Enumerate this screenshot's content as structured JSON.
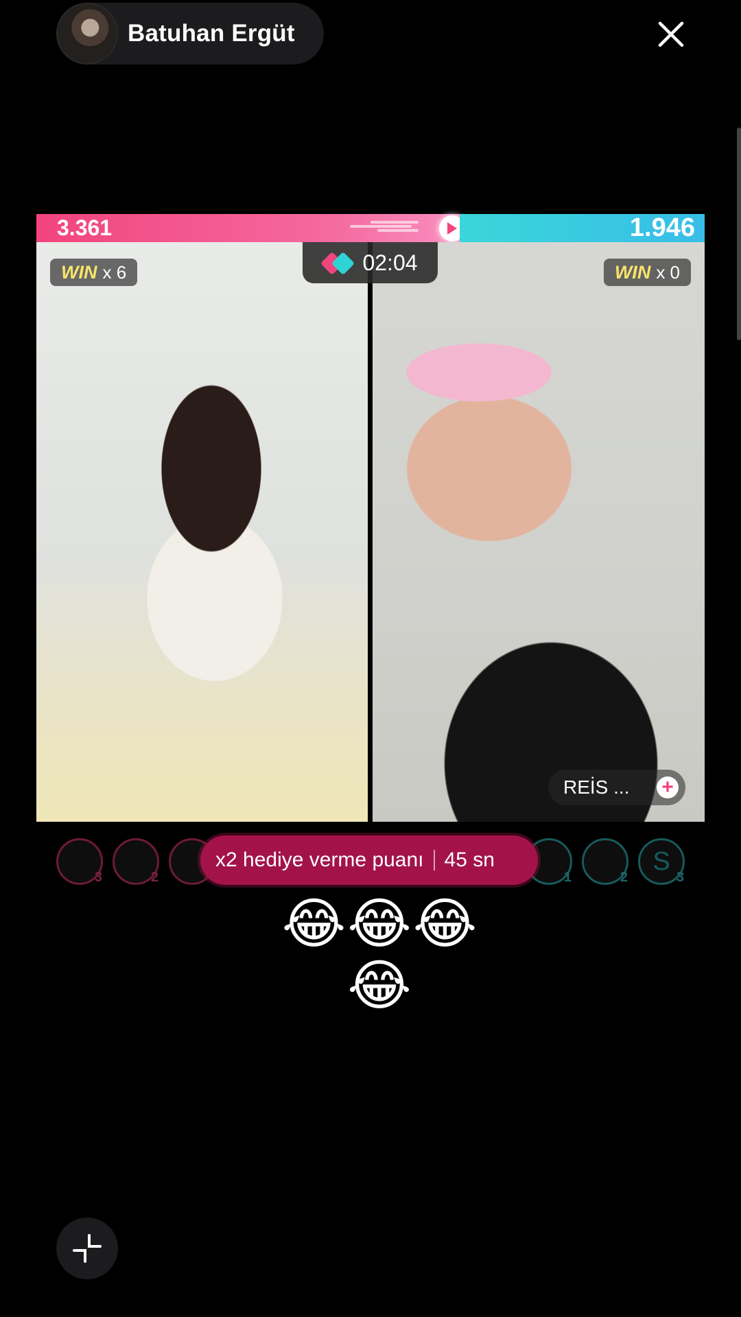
{
  "header": {
    "host_name": "Batuhan Ergüt",
    "avatar_icon": "user-avatar",
    "close_icon": "close-icon"
  },
  "battle": {
    "left_score": "3.361",
    "right_score": "1.946",
    "left_share": 0.633,
    "timer_icon": "battle-versus-icon",
    "timer": "02:04",
    "left_win": {
      "label": "WIN",
      "count": "x 6"
    },
    "right_win": {
      "label": "WIN",
      "count": "x 0"
    },
    "follow_label": "REİS ...",
    "follow_icon": "plus-icon",
    "colors": {
      "left": "#f2447d",
      "right": "#3ad6d9",
      "boost": "#a3134a",
      "win": "#f8e36a"
    }
  },
  "supporters": {
    "left_counts": [
      "3",
      "2",
      ""
    ],
    "right_counts": [
      "1",
      "2",
      "3"
    ],
    "right_letter": "S"
  },
  "boost": {
    "text": "x2 hediye verme puanı",
    "time": "45 sn"
  },
  "comment": {
    "emojis": "😂😂😂😂"
  },
  "footer": {
    "minimize_icon": "minimize-icon"
  }
}
